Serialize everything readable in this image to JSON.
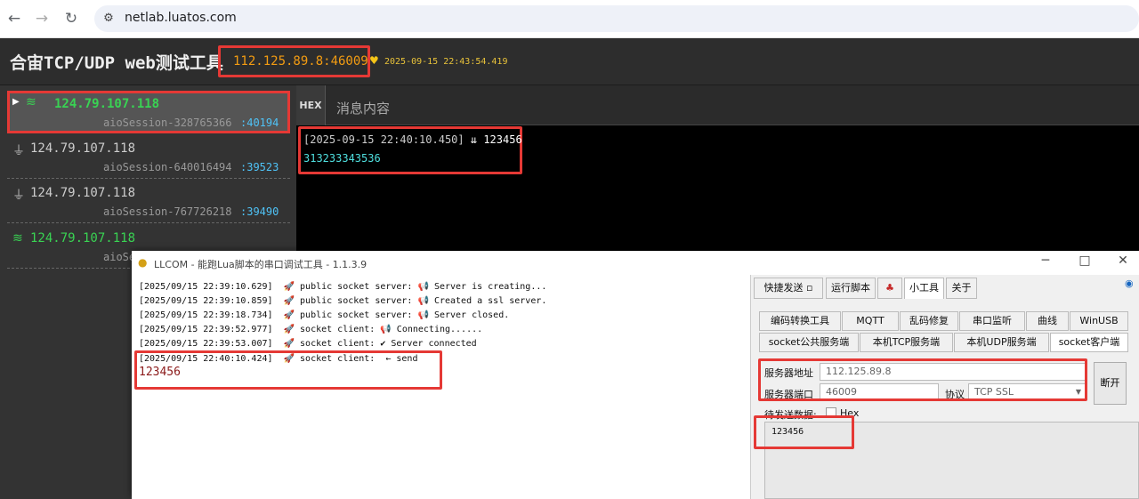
{
  "browser": {
    "url": "netlab.luatos.com",
    "back_icon": "←",
    "forward_icon": "→",
    "reload_icon": "↻",
    "site_icon": "⚙"
  },
  "web": {
    "title": "合宙TCP/UDP web测试工具",
    "server_addr": "112.125.89.8:46009",
    "server_time": "2025-09-15 22:43:54.419",
    "hex_label": "HEX",
    "msg_placeholder": "消息内容",
    "sessions": [
      {
        "ip": "124.79.107.118",
        "name": "aioSession-328765366",
        "port": ":40194",
        "icon": "wifi"
      },
      {
        "ip": "124.79.107.118",
        "name": "aioSession-640016494",
        "port": ":39523",
        "icon": "plug"
      },
      {
        "ip": "124.79.107.118",
        "name": "aioSession-767726218",
        "port": ":39490",
        "icon": "plug"
      },
      {
        "ip": "124.79.107.118",
        "name": "aioSe",
        "port": "",
        "icon": "wifi"
      }
    ],
    "message": {
      "time": "[2025-09-15 22:40:10.450]",
      "text": "123456",
      "hex": "313233343536"
    }
  },
  "llcom": {
    "title": "LLCOM - 能跑Lua脚本的串口调试工具 - 1.1.3.9",
    "logs": [
      "[2025/09/15 22:39:10.629]  🚀 public socket server: 📢 Server is creating...",
      "[2025/09/15 22:39:10.859]  🚀 public socket server: 📢 Created a ssl server.",
      "[2025/09/15 22:39:18.734]  🚀 public socket server: 📢 Server closed.",
      "[2025/09/15 22:39:52.977]  🚀 socket client: 📢 Connecting......",
      "[2025/09/15 22:39:53.007]  🚀 socket client: ✔ Server connected",
      "[2025/09/15 22:40:10.424]  🚀 socket client:  ← send"
    ],
    "received": "123456",
    "tabs": [
      "快捷发送",
      "运行脚本",
      "",
      "小工具",
      "关于"
    ],
    "subtabs_row1": [
      "编码转换工具",
      "MQTT",
      "乱码修复",
      "串口监听",
      "曲线",
      "WinUSB"
    ],
    "subtabs_row2": [
      "socket公共服务端",
      "本机TCP服务端",
      "本机UDP服务端",
      "socket客户端"
    ],
    "form": {
      "server_addr_label": "服务器地址",
      "server_addr": "112.125.89.8",
      "server_port_label": "服务器端口",
      "server_port": "46009",
      "protocol_label": "协议",
      "protocol": "TCP SSL",
      "disconnect": "断开",
      "send_label": "待发送数据:",
      "hex_label": "Hex",
      "send_data": "123456"
    }
  }
}
